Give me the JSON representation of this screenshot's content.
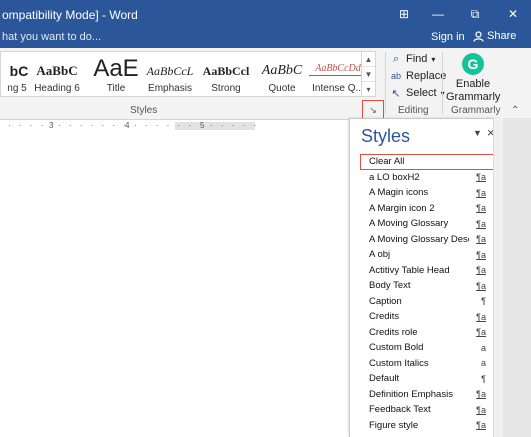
{
  "window": {
    "title": "ompatibility Mode] - Word",
    "controls": [
      "⊞",
      "—",
      "⧉",
      "✕"
    ]
  },
  "tellme": {
    "text": "hat you want to do...",
    "signin": "Sign in",
    "share": "Share"
  },
  "ribbon": {
    "styles_gallery": [
      {
        "sample": "bC",
        "name": "ng 5"
      },
      {
        "sample": "AaBbC",
        "name": "Heading 6"
      },
      {
        "sample": "AaE",
        "name": "Title"
      },
      {
        "sample": "AaBbCcL",
        "name": "Emphasis"
      },
      {
        "sample": "AaBbCcl",
        "name": "Strong"
      },
      {
        "sample": "AaBbC",
        "name": "Quote"
      },
      {
        "sample": "AaBbCcDd",
        "name": "Intense Q..."
      }
    ],
    "styles_group_label": "Styles",
    "editing": {
      "find": "Find",
      "replace": "Replace",
      "select": "Select",
      "group_label": "Editing"
    },
    "grammarly": {
      "line1": "Enable",
      "line2": "Grammarly",
      "group_label": "Grammarly"
    }
  },
  "ruler": {
    "marks": [
      "3",
      "4",
      "5"
    ]
  },
  "styles_pane": {
    "title": "Styles",
    "items": [
      {
        "label": "Clear All",
        "marker": ""
      },
      {
        "label": "a LO boxH2",
        "marker": "¶a"
      },
      {
        "label": "A Magin icons",
        "marker": "¶a"
      },
      {
        "label": "A Margin icon 2",
        "marker": "¶a"
      },
      {
        "label": "A Moving Glossary",
        "marker": "¶a"
      },
      {
        "label": "A Moving Glossary Descr",
        "marker": "¶a"
      },
      {
        "label": "A obj",
        "marker": "¶a"
      },
      {
        "label": "Actitivy Table Head",
        "marker": "¶a"
      },
      {
        "label": "Body Text",
        "marker": "¶a"
      },
      {
        "label": "Caption",
        "marker": "¶"
      },
      {
        "label": "Credits",
        "marker": "¶a"
      },
      {
        "label": "Credits role",
        "marker": "¶a"
      },
      {
        "label": "Custom Bold",
        "marker": "a"
      },
      {
        "label": "Custom Italics",
        "marker": "a"
      },
      {
        "label": "Default",
        "marker": "¶"
      },
      {
        "label": "Definition Emphasis",
        "marker": "¶a"
      },
      {
        "label": "Feedback Text",
        "marker": "¶a"
      },
      {
        "label": "Figure style",
        "marker": "¶a"
      }
    ]
  },
  "colors": {
    "accent": "#2b579a",
    "highlight_border": "#e74c3c",
    "grammarly": "#15c39a"
  }
}
